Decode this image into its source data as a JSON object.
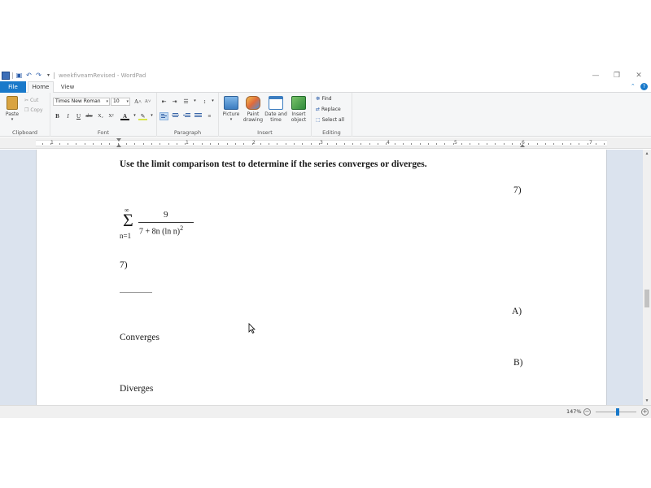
{
  "window": {
    "title": "weekfiveamRevised - WordPad",
    "minimize": "—",
    "restore": "❐",
    "close": "✕"
  },
  "tabs": {
    "file": "File",
    "home": "Home",
    "view": "View"
  },
  "ribbon": {
    "clipboard": {
      "paste": "Paste",
      "cut": "Cut",
      "copy": "Copy",
      "label": "Clipboard"
    },
    "font": {
      "family": "Times New Roman",
      "size": "10",
      "grow": "A˄",
      "shrink": "A˅",
      "bold": "B",
      "italic": "I",
      "underline": "U",
      "strike": "abc",
      "subscript": "X₂",
      "superscript": "X²",
      "label": "Font"
    },
    "paragraph": {
      "label": "Paragraph"
    },
    "insert": {
      "picture": "Picture",
      "paint1": "Paint",
      "paint2": "drawing",
      "date1": "Date and",
      "date2": "time",
      "obj1": "Insert",
      "obj2": "object",
      "label": "Insert"
    },
    "editing": {
      "find": "Find",
      "replace": "Replace",
      "select_all": "Select all",
      "label": "Editing"
    }
  },
  "ruler": {
    "numbers": [
      "1",
      "1",
      "2",
      "3",
      "4",
      "5",
      "6",
      "7"
    ]
  },
  "document": {
    "instruction": "Use the limit comparison test to determine if the series converges or diverges.",
    "question_number_right": "7)",
    "series": {
      "upper": "∞",
      "sigma": "Σ",
      "lower": "n=1",
      "numerator": "9",
      "denominator": "7 + 8n (ln n)",
      "exponent": "2"
    },
    "question_number_left": "7)",
    "answer_blank": "_______",
    "choice_a_label": "A)",
    "choice_a_text": "Converges",
    "choice_b_label": "B)",
    "choice_b_text": "Diverges"
  },
  "status": {
    "zoom": "147%",
    "zoom_out": "−",
    "zoom_in": "+"
  },
  "colors": {
    "accent": "#1979ca",
    "page_background": "#dbe3ee"
  }
}
